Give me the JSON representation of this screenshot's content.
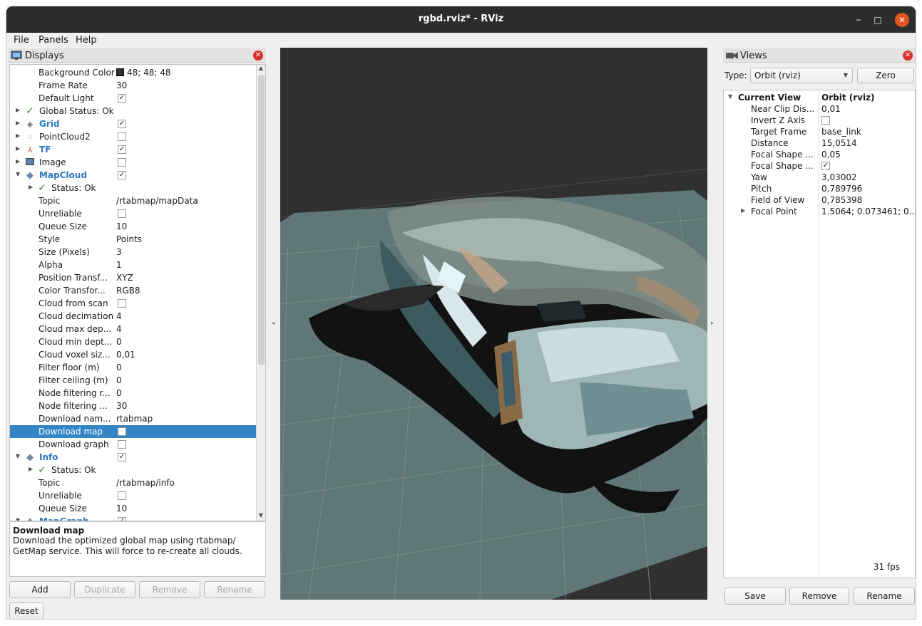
{
  "window": {
    "title": "rgbd.rviz* - RViz",
    "minimize_glyph": "–",
    "maximize_glyph": "□",
    "close_glyph": "✕"
  },
  "menu": [
    "File",
    "Panels",
    "Help"
  ],
  "displays_panel": {
    "title": "Displays",
    "rows": [
      {
        "label": "Background Color",
        "value": "48; 48; 48",
        "kind": "color",
        "color": "#303030",
        "indent": 40
      },
      {
        "label": "Frame Rate",
        "value": "30",
        "indent": 40
      },
      {
        "label": "Default Light",
        "checked": true,
        "kind": "check",
        "indent": 40
      },
      {
        "label": "Global Status: Ok",
        "icon": "check-icon",
        "arrow": true,
        "indent": 22
      },
      {
        "label": "Grid",
        "blue": true,
        "icon": "grid-icon",
        "checked": true,
        "kind": "check",
        "arrow": true,
        "indent": 22
      },
      {
        "label": "PointCloud2",
        "icon": "pointcloud-icon",
        "checked": false,
        "kind": "check",
        "arrow": true,
        "indent": 22
      },
      {
        "label": "TF",
        "blue": true,
        "icon": "tf-axes-icon",
        "checked": true,
        "kind": "check",
        "arrow": true,
        "indent": 22
      },
      {
        "label": "Image",
        "icon": "image-icon",
        "checked": false,
        "kind": "check",
        "arrow": true,
        "indent": 22
      },
      {
        "label": "MapCloud",
        "blue": true,
        "icon": "display-diamond-icon",
        "checked": true,
        "kind": "check",
        "arrow": true,
        "expanded": true,
        "indent": 22
      },
      {
        "label": "Status: Ok",
        "icon": "check-icon",
        "arrow": true,
        "indent": 40,
        "sub": true
      },
      {
        "label": "Topic",
        "value": "/rtabmap/mapData",
        "indent": 40
      },
      {
        "label": "Unreliable",
        "checked": false,
        "kind": "check",
        "indent": 40
      },
      {
        "label": "Queue Size",
        "value": "10",
        "indent": 40
      },
      {
        "label": "Style",
        "value": "Points",
        "indent": 40
      },
      {
        "label": "Size (Pixels)",
        "value": "3",
        "indent": 40
      },
      {
        "label": "Alpha",
        "value": "1",
        "indent": 40
      },
      {
        "label": "Position Transf...",
        "value": "XYZ",
        "indent": 40
      },
      {
        "label": "Color Transfor...",
        "value": "RGB8",
        "indent": 40
      },
      {
        "label": "Cloud from scan",
        "checked": false,
        "kind": "check",
        "indent": 40
      },
      {
        "label": "Cloud decimation",
        "value": "4",
        "indent": 40
      },
      {
        "label": "Cloud max dep...",
        "value": "4",
        "indent": 40
      },
      {
        "label": "Cloud min dept...",
        "value": "0",
        "indent": 40
      },
      {
        "label": "Cloud voxel siz...",
        "value": "0,01",
        "indent": 40
      },
      {
        "label": "Filter floor (m)",
        "value": "0",
        "indent": 40
      },
      {
        "label": "Filter ceiling (m)",
        "value": "0",
        "indent": 40
      },
      {
        "label": "Node filtering r...",
        "value": "0",
        "indent": 40
      },
      {
        "label": "Node filtering ...",
        "value": "30",
        "indent": 40
      },
      {
        "label": "Download nam...",
        "value": "rtabmap",
        "indent": 40
      },
      {
        "label": "Download map",
        "checked": false,
        "kind": "check",
        "indent": 40,
        "selected": true
      },
      {
        "label": "Download graph",
        "checked": false,
        "kind": "check",
        "indent": 40
      },
      {
        "label": "Info",
        "blue": true,
        "icon": "display-diamond-icon",
        "checked": true,
        "kind": "check",
        "arrow": true,
        "expanded": true,
        "indent": 22
      },
      {
        "label": "Status: Ok",
        "icon": "check-icon",
        "arrow": true,
        "indent": 40,
        "sub": true
      },
      {
        "label": "Topic",
        "value": "/rtabmap/info",
        "indent": 40
      },
      {
        "label": "Unreliable",
        "checked": false,
        "kind": "check",
        "indent": 40
      },
      {
        "label": "Queue Size",
        "value": "10",
        "indent": 40
      },
      {
        "label": "MapGraph",
        "blue": true,
        "icon": "display-diamond-icon",
        "checked": true,
        "kind": "check",
        "arrow": true,
        "expanded": true,
        "indent": 22
      }
    ],
    "description": {
      "title": "Download map",
      "text": "Download the optimized global map using rtabmap/ GetMap service. This will force to re-create all clouds."
    },
    "buttons": {
      "add": "Add",
      "duplicate": "Duplicate",
      "remove": "Remove",
      "rename": "Rename",
      "reset": "Reset"
    }
  },
  "views_panel": {
    "title": "Views",
    "type_label": "Type:",
    "type_value": "Orbit (rviz)",
    "zero_button": "Zero",
    "rows": [
      {
        "label": "Current View",
        "value": "Orbit (rviz)",
        "bold": true,
        "arrow": true
      },
      {
        "label": "Near Clip Dis...",
        "value": "0,01"
      },
      {
        "label": "Invert Z Axis",
        "kind": "check",
        "checked": false
      },
      {
        "label": "Target Frame",
        "value": "base_link"
      },
      {
        "label": "Distance",
        "value": "15,0514"
      },
      {
        "label": "Focal Shape ...",
        "value": "0,05"
      },
      {
        "label": "Focal Shape ...",
        "kind": "check",
        "checked": true
      },
      {
        "label": "Yaw",
        "value": "3,03002"
      },
      {
        "label": "Pitch",
        "value": "0,789796"
      },
      {
        "label": "Field of View",
        "value": "0,785398"
      },
      {
        "label": "Focal Point",
        "value": "1.5064; 0.073461; 0...",
        "arrow": true
      }
    ],
    "buttons": {
      "save": "Save",
      "remove": "Remove",
      "rename": "Rename"
    }
  },
  "status": {
    "fps": "31 fps"
  },
  "colors": {
    "viewport_bg": "#303030",
    "grid_plane": "#5f7776",
    "selection": "#3385c6",
    "link_blue": "#2b78c1"
  }
}
